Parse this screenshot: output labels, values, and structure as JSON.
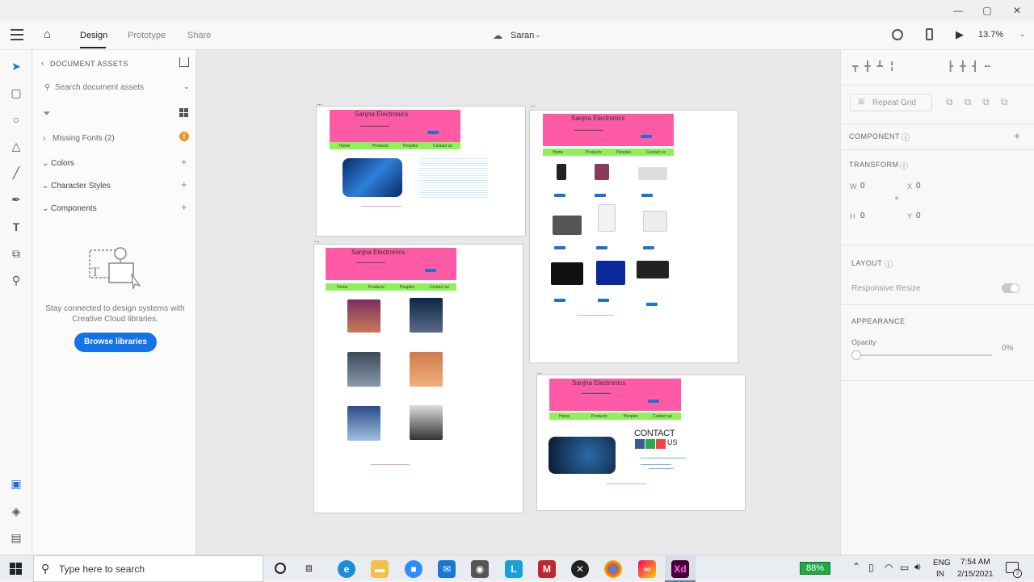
{
  "window": {
    "minimize": "—",
    "maximize": "▢",
    "close": "✕"
  },
  "appbar": {
    "tabs": [
      "Design",
      "Prototype",
      "Share"
    ],
    "user": "Saran",
    "zoom": "13.7%"
  },
  "assets": {
    "title": "DOCUMENT ASSETS",
    "search_placeholder": "Search document assets",
    "missing_fonts": "Missing Fonts (2)",
    "sections": [
      "Colors",
      "Character Styles",
      "Components"
    ],
    "stay_text": "Stay connected to design systems with Creative Cloud libraries.",
    "browse": "Browse libraries"
  },
  "props": {
    "repeat_grid": "Repeat Grid",
    "component": "COMPONENT",
    "transform": "TRANSFORM",
    "w_label": "W",
    "w_val": "0",
    "x_label": "X",
    "x_val": "0",
    "h_label": "H",
    "h_val": "0",
    "y_label": "Y",
    "y_val": "0",
    "layout": "LAYOUT",
    "responsive": "Responsive Resize",
    "appearance": "APPEARANCE",
    "opacity": "Opacity",
    "opacity_val": "0%"
  },
  "artboard": {
    "site_title": "Sanjna Electronics",
    "nav": [
      "Home",
      "Products",
      "Peoples",
      "Contact us"
    ],
    "contact_heading": "CONTACT",
    "contact_us": "US",
    "ellipsis": "..."
  },
  "taskbar": {
    "search_placeholder": "Type here to search",
    "battery": "88%",
    "lang1": "ENG",
    "lang2": "IN",
    "time": "7:54 AM",
    "date": "2/15/2021",
    "notif": "3"
  },
  "colors": {
    "banner": "#ff5aa5",
    "nav": "#8ff05a",
    "accent": "#1f6fd6"
  }
}
